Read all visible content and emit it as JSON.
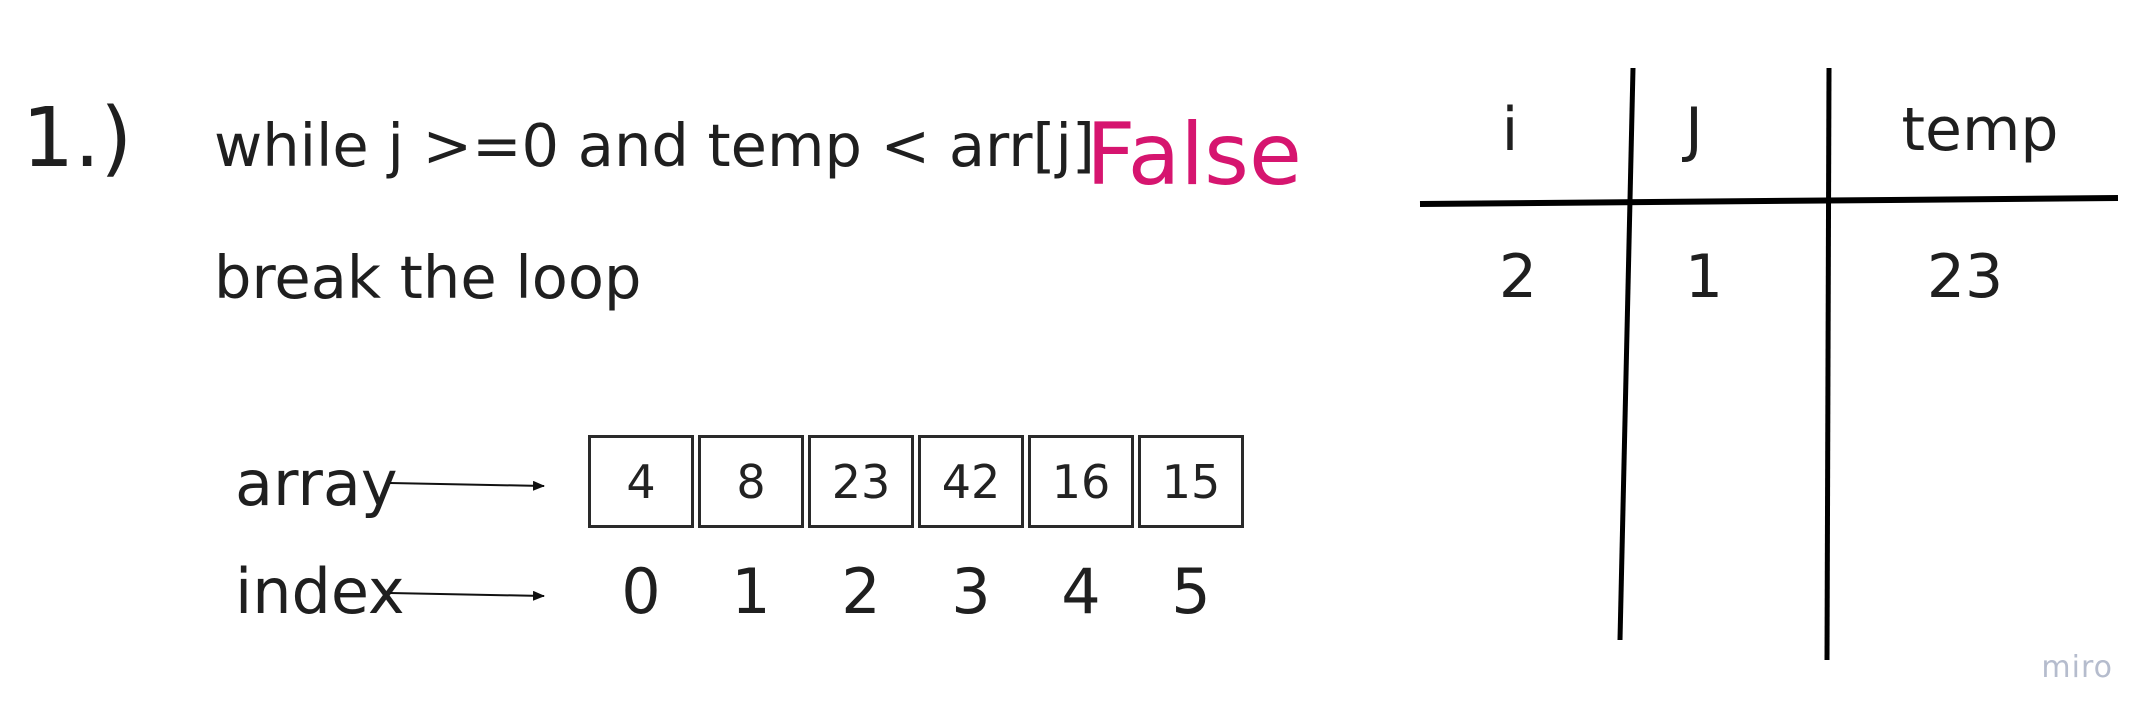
{
  "step_label": "1.)",
  "condition": "while j >=0 and temp < arr[j]",
  "result": "False",
  "action": "break the loop",
  "array_label": "array",
  "index_label": "index",
  "array_values": [
    "4",
    "8",
    "23",
    "42",
    "16",
    "15"
  ],
  "indices": [
    "0",
    "1",
    "2",
    "3",
    "4",
    "5"
  ],
  "trace_table": {
    "headers": [
      "i",
      "J",
      "temp"
    ],
    "row": [
      "2",
      "1",
      "23"
    ]
  },
  "watermark": "miro",
  "colors": {
    "result": "#d6156f",
    "text": "#1f1f1f",
    "watermark": "#b5bccd"
  }
}
